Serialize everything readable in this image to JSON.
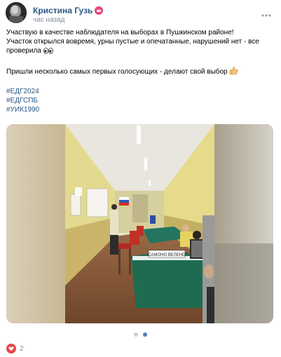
{
  "post": {
    "author": "Кристина Гузь",
    "time": "час назад",
    "lines": [
      "Участвую в качестве наблюдателя на выборах в Пушкинском районе!",
      "Участок открылся вовремя, урны пустые и опечатанные, нарушений нет - все",
      "проверила"
    ],
    "line2": "Пришли несколько самых первых голосующих - делают свой выбор",
    "hashtags": [
      "#ЕДГ2024",
      "#ЕДГСПБ",
      "#УИК1990"
    ]
  },
  "photo": {
    "table_sign": "САМОНО ВЕЛЕНО"
  },
  "carousel": {
    "count": 2,
    "active": 2
  },
  "likes": {
    "count": "2"
  },
  "colors": {
    "link": "#2a5885",
    "muted": "#818c99",
    "like": "#e64646",
    "active_dot": "#5181b8"
  }
}
